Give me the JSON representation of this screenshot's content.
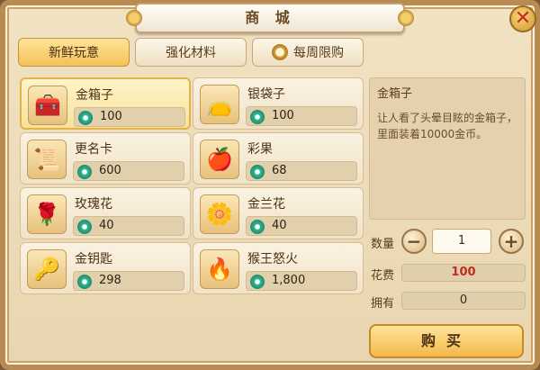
{
  "window": {
    "title": "商 城",
    "close_icon": "close-icon"
  },
  "tabs": [
    {
      "label": "新鲜玩意",
      "active": true
    },
    {
      "label": "强化材料",
      "active": false
    },
    {
      "label": "每周限购",
      "active": false,
      "icon": "clock-icon"
    }
  ],
  "items": [
    {
      "name": "金箱子",
      "price": "100",
      "icon": "gold-chest-icon",
      "glyph": "🧰",
      "selected": true
    },
    {
      "name": "银袋子",
      "price": "100",
      "icon": "silver-bag-icon",
      "glyph": "👝"
    },
    {
      "name": "更名卡",
      "price": "600",
      "icon": "rename-card-icon",
      "glyph": "📜"
    },
    {
      "name": "彩果",
      "price": "68",
      "icon": "color-fruit-icon",
      "glyph": "🍎"
    },
    {
      "name": "玫瑰花",
      "price": "40",
      "icon": "rose-icon",
      "glyph": "🌹"
    },
    {
      "name": "金兰花",
      "price": "40",
      "icon": "golden-orchid-icon",
      "glyph": "🌼"
    },
    {
      "name": "金钥匙",
      "price": "298",
      "icon": "golden-key-icon",
      "glyph": "🔑"
    },
    {
      "name": "猴王怒火",
      "price": "1,800",
      "icon": "monkey-king-fury-icon",
      "glyph": "🔥"
    }
  ],
  "detail": {
    "title": "金箱子",
    "description": "让人看了头晕目眩的金箱子，里面装着10000金币。"
  },
  "purchase": {
    "quantity_label": "数量",
    "quantity_value": "1",
    "cost_label": "花费",
    "cost_value": "100",
    "owned_label": "拥有",
    "owned_value": "0",
    "buy_label": "购买"
  },
  "colors": {
    "accent": "#f3c257",
    "cost": "#c62b1c",
    "currency": "#1f8c6c"
  }
}
